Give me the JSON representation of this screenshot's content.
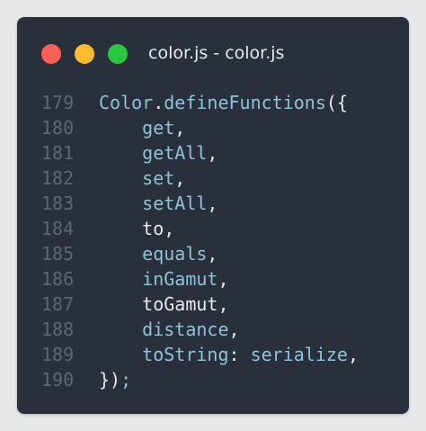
{
  "window": {
    "title": "color.js - color.js",
    "controls": [
      {
        "name": "close",
        "color": "#fe5f57"
      },
      {
        "name": "minimize",
        "color": "#febc2e"
      },
      {
        "name": "maximize",
        "color": "#28c840"
      }
    ]
  },
  "colors": {
    "background": "#e7e8ea",
    "editor": "#2a303b",
    "line_number": "#5d6674",
    "text": "#e6e8ec",
    "identifier": "#8fc3d8"
  },
  "code": {
    "lines": [
      {
        "num": "179",
        "indent": "",
        "tokens": [
          {
            "t": "Color",
            "c": "prop"
          },
          {
            "t": ".",
            "c": "punc"
          },
          {
            "t": "defineFunctions",
            "c": "prop"
          },
          {
            "t": "({",
            "c": "punc"
          }
        ]
      },
      {
        "num": "180",
        "indent": "    ",
        "tokens": [
          {
            "t": "get",
            "c": "prop"
          },
          {
            "t": ",",
            "c": "punc"
          }
        ]
      },
      {
        "num": "181",
        "indent": "    ",
        "tokens": [
          {
            "t": "getAll",
            "c": "prop"
          },
          {
            "t": ",",
            "c": "punc"
          }
        ]
      },
      {
        "num": "182",
        "indent": "    ",
        "tokens": [
          {
            "t": "set",
            "c": "prop"
          },
          {
            "t": ",",
            "c": "punc"
          }
        ]
      },
      {
        "num": "183",
        "indent": "    ",
        "tokens": [
          {
            "t": "setAll",
            "c": "prop"
          },
          {
            "t": ",",
            "c": "punc"
          }
        ]
      },
      {
        "num": "184",
        "indent": "    ",
        "tokens": [
          {
            "t": "to",
            "c": "plain"
          },
          {
            "t": ",",
            "c": "punc"
          }
        ]
      },
      {
        "num": "185",
        "indent": "    ",
        "tokens": [
          {
            "t": "equals",
            "c": "prop"
          },
          {
            "t": ",",
            "c": "punc"
          }
        ]
      },
      {
        "num": "186",
        "indent": "    ",
        "tokens": [
          {
            "t": "inGamut",
            "c": "prop"
          },
          {
            "t": ",",
            "c": "punc"
          }
        ]
      },
      {
        "num": "187",
        "indent": "    ",
        "tokens": [
          {
            "t": "toGamut",
            "c": "plain"
          },
          {
            "t": ",",
            "c": "punc"
          }
        ]
      },
      {
        "num": "188",
        "indent": "    ",
        "tokens": [
          {
            "t": "distance",
            "c": "prop"
          },
          {
            "t": ",",
            "c": "punc"
          }
        ]
      },
      {
        "num": "189",
        "indent": "    ",
        "tokens": [
          {
            "t": "toString",
            "c": "prop"
          },
          {
            "t": ": ",
            "c": "punc"
          },
          {
            "t": "serialize",
            "c": "prop"
          },
          {
            "t": ",",
            "c": "punc"
          }
        ]
      },
      {
        "num": "190",
        "indent": "",
        "tokens": [
          {
            "t": "})",
            "c": "punc"
          },
          {
            "t": ";",
            "c": "semi"
          }
        ]
      }
    ]
  }
}
